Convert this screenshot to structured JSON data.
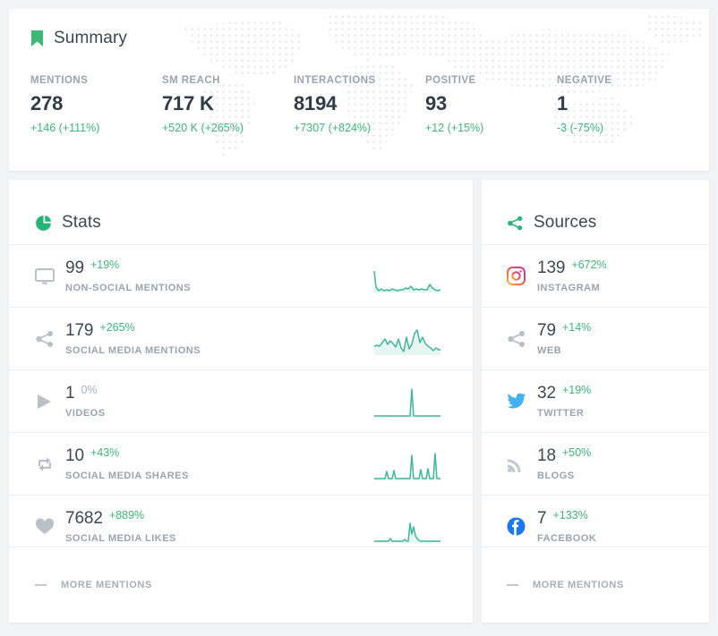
{
  "summary": {
    "title": "Summary",
    "icon": "bookmark-icon",
    "metrics": [
      {
        "label": "MENTIONS",
        "value": "278",
        "delta": "+146 (+111%)"
      },
      {
        "label": "SM REACH",
        "value": "717 K",
        "delta": "+520 K (+265%)"
      },
      {
        "label": "INTERACTIONS",
        "value": "8194",
        "delta": "+7307 (+824%)"
      },
      {
        "label": "POSITIVE",
        "value": "93",
        "delta": "+12 (+15%)"
      },
      {
        "label": "NEGATIVE",
        "value": "1",
        "delta": "-3 (-75%)"
      }
    ]
  },
  "stats": {
    "title": "Stats",
    "icon": "pie-chart-icon",
    "rows": [
      {
        "icon": "monitor-icon",
        "value": "99",
        "pct": "+19%",
        "pct_neutral": false,
        "label": "NON-SOCIAL MENTIONS"
      },
      {
        "icon": "share-icon",
        "value": "179",
        "pct": "+265%",
        "pct_neutral": false,
        "label": "SOCIAL MEDIA MENTIONS"
      },
      {
        "icon": "play-icon",
        "value": "1",
        "pct": "0%",
        "pct_neutral": true,
        "label": "VIDEOS"
      },
      {
        "icon": "retweet-icon",
        "value": "10",
        "pct": "+43%",
        "pct_neutral": false,
        "label": "SOCIAL MEDIA SHARES"
      },
      {
        "icon": "heart-icon",
        "value": "7682",
        "pct": "+889%",
        "pct_neutral": false,
        "label": "SOCIAL MEDIA LIKES"
      }
    ],
    "more_label": "MORE MENTIONS"
  },
  "sources": {
    "title": "Sources",
    "icon": "share-icon",
    "rows": [
      {
        "icon": "instagram-icon",
        "value": "139",
        "pct": "+672%",
        "label": "INSTAGRAM"
      },
      {
        "icon": "share-icon",
        "value": "79",
        "pct": "+14%",
        "label": "WEB"
      },
      {
        "icon": "twitter-icon",
        "value": "32",
        "pct": "+19%",
        "label": "TWITTER"
      },
      {
        "icon": "rss-icon",
        "value": "18",
        "pct": "+50%",
        "label": "BLOGS"
      },
      {
        "icon": "facebook-icon",
        "value": "7",
        "pct": "+133%",
        "label": "FACEBOOK"
      }
    ],
    "more_label": "MORE MENTIONS"
  },
  "chart_data": [
    {
      "type": "line",
      "title": "NON-SOCIAL MENTIONS sparkline",
      "values": [
        2,
        14,
        3,
        2,
        4,
        2,
        3,
        2,
        4,
        3,
        2,
        3,
        3,
        5,
        4,
        6,
        3,
        4,
        3,
        4,
        3,
        3,
        7,
        4,
        3,
        2,
        3
      ],
      "ylim": [
        0,
        14
      ],
      "grid": false
    },
    {
      "type": "line",
      "title": "SOCIAL MEDIA MENTIONS sparkline",
      "values": [
        5,
        6,
        5,
        7,
        9,
        6,
        8,
        7,
        5,
        9,
        5,
        3,
        10,
        4,
        8,
        5,
        12,
        14,
        8,
        10,
        7,
        6,
        5,
        4,
        5,
        4,
        4
      ],
      "ylim": [
        0,
        14
      ],
      "grid": false
    },
    {
      "type": "line",
      "title": "VIDEOS sparkline",
      "values": [
        0,
        0,
        0,
        0,
        0,
        0,
        0,
        0,
        0,
        0,
        0,
        0,
        0,
        0,
        0,
        0,
        14,
        0,
        0,
        0,
        0,
        0,
        0,
        0,
        0,
        0,
        0
      ],
      "ylim": [
        0,
        14
      ],
      "grid": false
    },
    {
      "type": "line",
      "title": "SOCIAL MEDIA SHARES sparkline",
      "values": [
        0,
        0,
        0,
        0,
        0,
        3,
        0,
        3,
        0,
        0,
        0,
        0,
        0,
        0,
        11,
        0,
        0,
        0,
        4,
        0,
        2,
        0,
        4,
        0,
        12,
        0,
        0
      ],
      "ylim": [
        0,
        14
      ],
      "grid": false
    },
    {
      "type": "line",
      "title": "SOCIAL MEDIA LIKES sparkline",
      "values": [
        0,
        0,
        0,
        0,
        0,
        1,
        0,
        0,
        0,
        0,
        0,
        1,
        0,
        9,
        4,
        7,
        2,
        1,
        1,
        0,
        0,
        0,
        0,
        0,
        0,
        0,
        0
      ],
      "ylim": [
        0,
        14
      ],
      "grid": false
    }
  ],
  "colors": {
    "accent_green": "#3cb878",
    "spark_line": "#3fb995",
    "text_dark": "#3d4852",
    "text_muted": "#9aa4b0",
    "page_bg": "#f2f3f5",
    "card_bg": "#ffffff"
  }
}
